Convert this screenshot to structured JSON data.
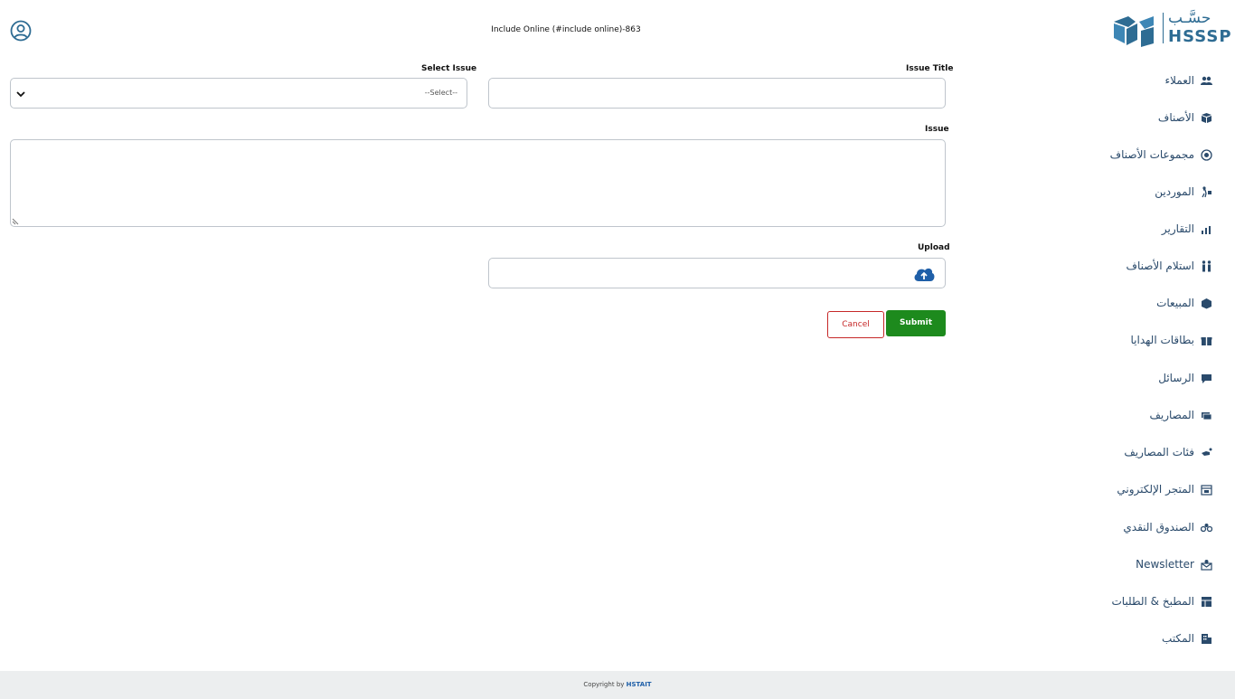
{
  "header": {
    "title": "Include Online (#include online)-863"
  },
  "logo": {
    "arabic": "حسَّـب",
    "latin": "HSSSP"
  },
  "form": {
    "select_issue_label": "Select Issue",
    "select_issue_value": "--Select--",
    "issue_title_label": "Issue Title",
    "issue_title_value": "",
    "issue_label": "Issue",
    "issue_value": "",
    "upload_label": "Upload",
    "cancel_label": "Cancel",
    "submit_label": "Submit"
  },
  "sidebar": {
    "items": [
      {
        "label": "العملاء",
        "icon": "users-icon"
      },
      {
        "label": "الأصناف",
        "icon": "box-icon"
      },
      {
        "label": "مجموعات الأصناف",
        "icon": "target-icon"
      },
      {
        "label": "الموردين",
        "icon": "supplier-icon"
      },
      {
        "label": "التقارير",
        "icon": "chart-icon"
      },
      {
        "label": "استلام الأصناف",
        "icon": "people-icon"
      },
      {
        "label": "المبيعات",
        "icon": "sales-icon"
      },
      {
        "label": "بطاقات الهدايا",
        "icon": "gift-icon"
      },
      {
        "label": "الرسائل",
        "icon": "message-icon"
      },
      {
        "label": "المصاريف",
        "icon": "money-icon"
      },
      {
        "label": "فئات المصاريف",
        "icon": "expense-category-icon"
      },
      {
        "label": "المتجر الإلكتروني",
        "icon": "store-icon"
      },
      {
        "label": "الصندوق النقدي",
        "icon": "cash-box-icon"
      },
      {
        "label": "Newsletter",
        "icon": "newsletter-icon"
      },
      {
        "label": "المطبخ & الطلبات",
        "icon": "kitchen-icon"
      },
      {
        "label": "المكتب",
        "icon": "office-icon"
      }
    ]
  },
  "footer": {
    "prefix": "Copyright by",
    "brand": "HSTAIT"
  },
  "colors": {
    "accent": "#2e6c93",
    "submit": "#1d8a1d",
    "cancel": "#c62828",
    "footer_bg": "#eceeef"
  }
}
